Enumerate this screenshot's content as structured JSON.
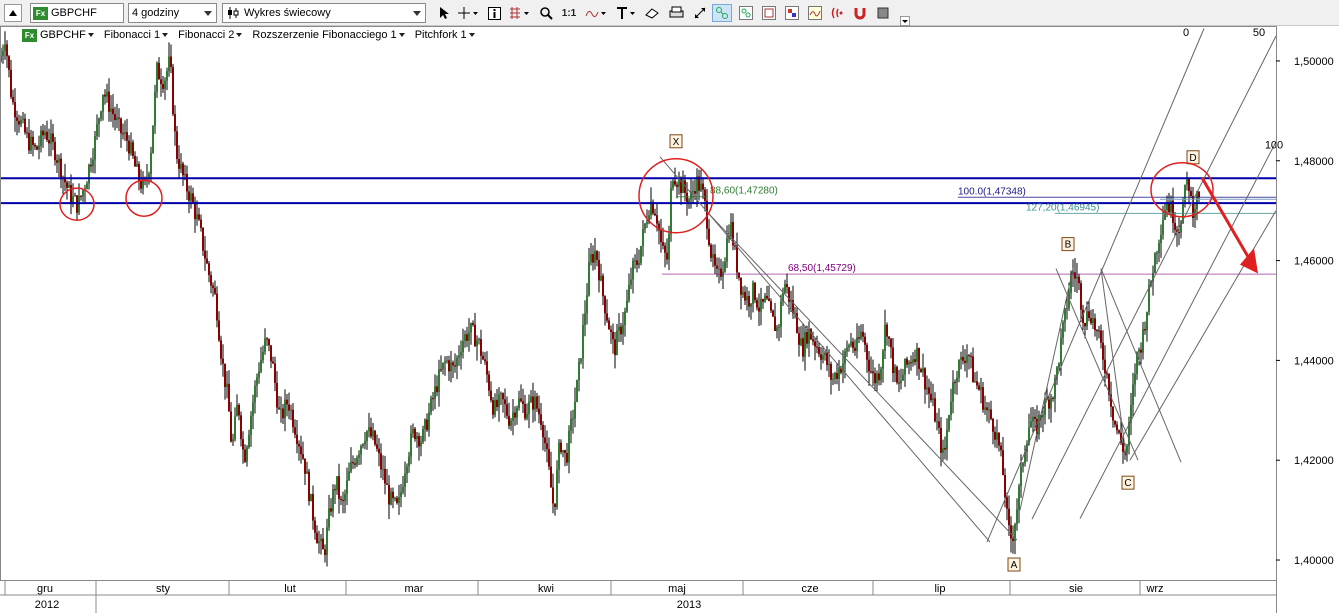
{
  "toolbar": {
    "symbol": "GBPCHF",
    "symbol_badge": "Fx",
    "interval": "4 godziny",
    "chart_type": "Wykres świecowy",
    "zoom_label": "1:1"
  },
  "legend": {
    "items": [
      "GBPCHF",
      "Fibonacci 1",
      "Fibonacci 2",
      "Rozszerzenie Fibonacciego 1",
      "Pitchfork 1"
    ]
  },
  "colors": {
    "bull": "#2e7d32",
    "bear": "#8b0000",
    "blue_line": "#0000aa",
    "circle": "#e02020",
    "arrow": "#e02020",
    "fib_green": "#2e7d32",
    "fib_purple": "#800080",
    "fib_blue": "#1a1a8a",
    "fib_teal": "#3d8f8f"
  },
  "chart_data": {
    "type": "candlestick",
    "symbol": "GBPCHF",
    "interval": "4 godziny",
    "ylim": [
      1.396,
      1.507
    ],
    "y_ticks": [
      "1,40000",
      "1,42000",
      "1,44000",
      "1,46000",
      "1,48000",
      "1,50000"
    ],
    "y_tick_values": [
      1.4,
      1.42,
      1.44,
      1.46,
      1.48,
      1.5
    ],
    "months": [
      "gru",
      "sty",
      "lut",
      "mar",
      "kwi",
      "maj",
      "cze",
      "lip",
      "sie",
      "wrz"
    ],
    "years": [
      "2012",
      "2013"
    ],
    "horizontal_levels": [
      1.4765,
      1.4715
    ],
    "fib_levels": [
      {
        "label": "88,60(1,47280)",
        "value": 1.4728
      },
      {
        "label": "68,50(1,45729)",
        "value": 1.45729
      },
      {
        "label": "100.0(1,47348)",
        "value": 1.47348
      },
      {
        "label": "127,20(1,46945)",
        "value": 1.46945
      }
    ],
    "pitchfork_labels": [
      "0",
      "50",
      "100"
    ],
    "pattern_points": [
      "X",
      "A",
      "B",
      "C",
      "D"
    ],
    "price_path": [
      [
        0,
        1.5
      ],
      [
        5,
        1.505
      ],
      [
        12,
        1.492
      ],
      [
        20,
        1.488
      ],
      [
        28,
        1.484
      ],
      [
        36,
        1.482
      ],
      [
        45,
        1.486
      ],
      [
        55,
        1.482
      ],
      [
        63,
        1.477
      ],
      [
        70,
        1.473
      ],
      [
        78,
        1.471
      ],
      [
        86,
        1.476
      ],
      [
        95,
        1.484
      ],
      [
        103,
        1.494
      ],
      [
        112,
        1.49
      ],
      [
        120,
        1.486
      ],
      [
        128,
        1.484
      ],
      [
        136,
        1.478
      ],
      [
        144,
        1.474
      ],
      [
        150,
        1.48
      ],
      [
        157,
        1.498
      ],
      [
        164,
        1.496
      ],
      [
        170,
        1.5
      ],
      [
        176,
        1.482
      ],
      [
        184,
        1.476
      ],
      [
        192,
        1.472
      ],
      [
        200,
        1.466
      ],
      [
        208,
        1.458
      ],
      [
        216,
        1.452
      ],
      [
        222,
        1.44
      ],
      [
        228,
        1.432
      ],
      [
        232,
        1.422
      ],
      [
        238,
        1.432
      ],
      [
        244,
        1.42
      ],
      [
        250,
        1.428
      ],
      [
        258,
        1.438
      ],
      [
        266,
        1.444
      ],
      [
        272,
        1.44
      ],
      [
        280,
        1.428
      ],
      [
        288,
        1.432
      ],
      [
        296,
        1.426
      ],
      [
        304,
        1.42
      ],
      [
        312,
        1.41
      ],
      [
        318,
        1.404
      ],
      [
        324,
        1.401
      ],
      [
        330,
        1.41
      ],
      [
        336,
        1.416
      ],
      [
        342,
        1.41
      ],
      [
        350,
        1.418
      ],
      [
        358,
        1.422
      ],
      [
        366,
        1.426
      ],
      [
        374,
        1.424
      ],
      [
        382,
        1.418
      ],
      [
        390,
        1.412
      ],
      [
        398,
        1.41
      ],
      [
        406,
        1.42
      ],
      [
        414,
        1.426
      ],
      [
        422,
        1.424
      ],
      [
        430,
        1.43
      ],
      [
        438,
        1.436
      ],
      [
        446,
        1.44
      ],
      [
        454,
        1.438
      ],
      [
        462,
        1.444
      ],
      [
        470,
        1.446
      ],
      [
        478,
        1.444
      ],
      [
        486,
        1.438
      ],
      [
        494,
        1.43
      ],
      [
        502,
        1.432
      ],
      [
        510,
        1.428
      ],
      [
        518,
        1.432
      ],
      [
        526,
        1.43
      ],
      [
        534,
        1.432
      ],
      [
        542,
        1.428
      ],
      [
        550,
        1.416
      ],
      [
        554,
        1.41
      ],
      [
        560,
        1.424
      ],
      [
        566,
        1.42
      ],
      [
        572,
        1.428
      ],
      [
        578,
        1.436
      ],
      [
        584,
        1.448
      ],
      [
        590,
        1.46
      ],
      [
        596,
        1.462
      ],
      [
        602,
        1.454
      ],
      [
        608,
        1.448
      ],
      [
        614,
        1.442
      ],
      [
        620,
        1.446
      ],
      [
        626,
        1.45
      ],
      [
        632,
        1.458
      ],
      [
        638,
        1.46
      ],
      [
        644,
        1.466
      ],
      [
        650,
        1.472
      ],
      [
        656,
        1.47
      ],
      [
        662,
        1.462
      ],
      [
        668,
        1.46
      ],
      [
        672,
        1.478
      ],
      [
        678,
        1.476
      ],
      [
        684,
        1.474
      ],
      [
        690,
        1.472
      ],
      [
        696,
        1.476
      ],
      [
        702,
        1.474
      ],
      [
        706,
        1.47
      ],
      [
        712,
        1.46
      ],
      [
        718,
        1.456
      ],
      [
        724,
        1.46
      ],
      [
        730,
        1.468
      ],
      [
        736,
        1.46
      ],
      [
        742,
        1.454
      ],
      [
        748,
        1.452
      ],
      [
        754,
        1.454
      ],
      [
        760,
        1.45
      ],
      [
        766,
        1.452
      ],
      [
        772,
        1.448
      ],
      [
        778,
        1.446
      ],
      [
        784,
        1.456
      ],
      [
        790,
        1.452
      ],
      [
        796,
        1.448
      ],
      [
        802,
        1.442
      ],
      [
        808,
        1.446
      ],
      [
        814,
        1.444
      ],
      [
        820,
        1.442
      ],
      [
        826,
        1.44
      ],
      [
        832,
        1.436
      ],
      [
        838,
        1.438
      ],
      [
        844,
        1.44
      ],
      [
        850,
        1.444
      ],
      [
        856,
        1.442
      ],
      [
        862,
        1.446
      ],
      [
        868,
        1.44
      ],
      [
        874,
        1.436
      ],
      [
        880,
        1.438
      ],
      [
        886,
        1.448
      ],
      [
        892,
        1.44
      ],
      [
        898,
        1.434
      ],
      [
        904,
        1.438
      ],
      [
        910,
        1.44
      ],
      [
        916,
        1.442
      ],
      [
        922,
        1.438
      ],
      [
        928,
        1.434
      ],
      [
        934,
        1.43
      ],
      [
        940,
        1.424
      ],
      [
        944,
        1.42
      ],
      [
        950,
        1.432
      ],
      [
        956,
        1.438
      ],
      [
        962,
        1.44
      ],
      [
        968,
        1.442
      ],
      [
        974,
        1.436
      ],
      [
        980,
        1.434
      ],
      [
        986,
        1.43
      ],
      [
        992,
        1.428
      ],
      [
        998,
        1.424
      ],
      [
        1004,
        1.416
      ],
      [
        1008,
        1.406
      ],
      [
        1012,
        1.404
      ],
      [
        1018,
        1.412
      ],
      [
        1024,
        1.422
      ],
      [
        1030,
        1.428
      ],
      [
        1036,
        1.426
      ],
      [
        1042,
        1.43
      ],
      [
        1048,
        1.432
      ],
      [
        1054,
        1.434
      ],
      [
        1060,
        1.442
      ],
      [
        1066,
        1.45
      ],
      [
        1072,
        1.458
      ],
      [
        1078,
        1.456
      ],
      [
        1084,
        1.448
      ],
      [
        1090,
        1.45
      ],
      [
        1096,
        1.446
      ],
      [
        1102,
        1.442
      ],
      [
        1108,
        1.436
      ],
      [
        1114,
        1.428
      ],
      [
        1120,
        1.424
      ],
      [
        1126,
        1.421
      ],
      [
        1130,
        1.428
      ],
      [
        1136,
        1.44
      ],
      [
        1142,
        1.444
      ],
      [
        1148,
        1.452
      ],
      [
        1154,
        1.46
      ],
      [
        1160,
        1.466
      ],
      [
        1166,
        1.472
      ],
      [
        1172,
        1.47
      ],
      [
        1178,
        1.466
      ],
      [
        1184,
        1.472
      ],
      [
        1188,
        1.477
      ],
      [
        1192,
        1.47
      ],
      [
        1196,
        1.472
      ],
      [
        1200,
        1.474
      ]
    ]
  }
}
